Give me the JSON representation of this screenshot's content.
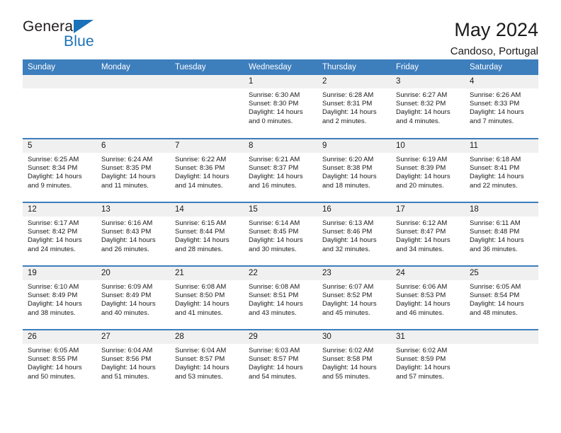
{
  "brand": {
    "name_part1": "General",
    "name_part2": "Blue",
    "accent_color": "#1b72b8",
    "triangle_icon": "triangle-icon"
  },
  "header": {
    "title": "May 2024",
    "subtitle": "Candoso, Portugal",
    "header_bg_color": "#3d7ebd",
    "header_text_color": "#ffffff"
  },
  "weekdays": [
    "Sunday",
    "Monday",
    "Tuesday",
    "Wednesday",
    "Thursday",
    "Friday",
    "Saturday"
  ],
  "labels": {
    "sunrise_prefix": "Sunrise:",
    "sunset_prefix": "Sunset:",
    "daylight_prefix": "Daylight:"
  },
  "weeks": [
    [
      {
        "day": "",
        "empty": true
      },
      {
        "day": "",
        "empty": true
      },
      {
        "day": "",
        "empty": true
      },
      {
        "day": "1",
        "sunrise": "Sunrise: 6:30 AM",
        "sunset": "Sunset: 8:30 PM",
        "daylight1": "Daylight: 14 hours",
        "daylight2": "and 0 minutes."
      },
      {
        "day": "2",
        "sunrise": "Sunrise: 6:28 AM",
        "sunset": "Sunset: 8:31 PM",
        "daylight1": "Daylight: 14 hours",
        "daylight2": "and 2 minutes."
      },
      {
        "day": "3",
        "sunrise": "Sunrise: 6:27 AM",
        "sunset": "Sunset: 8:32 PM",
        "daylight1": "Daylight: 14 hours",
        "daylight2": "and 4 minutes."
      },
      {
        "day": "4",
        "sunrise": "Sunrise: 6:26 AM",
        "sunset": "Sunset: 8:33 PM",
        "daylight1": "Daylight: 14 hours",
        "daylight2": "and 7 minutes."
      }
    ],
    [
      {
        "day": "5",
        "sunrise": "Sunrise: 6:25 AM",
        "sunset": "Sunset: 8:34 PM",
        "daylight1": "Daylight: 14 hours",
        "daylight2": "and 9 minutes."
      },
      {
        "day": "6",
        "sunrise": "Sunrise: 6:24 AM",
        "sunset": "Sunset: 8:35 PM",
        "daylight1": "Daylight: 14 hours",
        "daylight2": "and 11 minutes."
      },
      {
        "day": "7",
        "sunrise": "Sunrise: 6:22 AM",
        "sunset": "Sunset: 8:36 PM",
        "daylight1": "Daylight: 14 hours",
        "daylight2": "and 14 minutes."
      },
      {
        "day": "8",
        "sunrise": "Sunrise: 6:21 AM",
        "sunset": "Sunset: 8:37 PM",
        "daylight1": "Daylight: 14 hours",
        "daylight2": "and 16 minutes."
      },
      {
        "day": "9",
        "sunrise": "Sunrise: 6:20 AM",
        "sunset": "Sunset: 8:38 PM",
        "daylight1": "Daylight: 14 hours",
        "daylight2": "and 18 minutes."
      },
      {
        "day": "10",
        "sunrise": "Sunrise: 6:19 AM",
        "sunset": "Sunset: 8:39 PM",
        "daylight1": "Daylight: 14 hours",
        "daylight2": "and 20 minutes."
      },
      {
        "day": "11",
        "sunrise": "Sunrise: 6:18 AM",
        "sunset": "Sunset: 8:41 PM",
        "daylight1": "Daylight: 14 hours",
        "daylight2": "and 22 minutes."
      }
    ],
    [
      {
        "day": "12",
        "sunrise": "Sunrise: 6:17 AM",
        "sunset": "Sunset: 8:42 PM",
        "daylight1": "Daylight: 14 hours",
        "daylight2": "and 24 minutes."
      },
      {
        "day": "13",
        "sunrise": "Sunrise: 6:16 AM",
        "sunset": "Sunset: 8:43 PM",
        "daylight1": "Daylight: 14 hours",
        "daylight2": "and 26 minutes."
      },
      {
        "day": "14",
        "sunrise": "Sunrise: 6:15 AM",
        "sunset": "Sunset: 8:44 PM",
        "daylight1": "Daylight: 14 hours",
        "daylight2": "and 28 minutes."
      },
      {
        "day": "15",
        "sunrise": "Sunrise: 6:14 AM",
        "sunset": "Sunset: 8:45 PM",
        "daylight1": "Daylight: 14 hours",
        "daylight2": "and 30 minutes."
      },
      {
        "day": "16",
        "sunrise": "Sunrise: 6:13 AM",
        "sunset": "Sunset: 8:46 PM",
        "daylight1": "Daylight: 14 hours",
        "daylight2": "and 32 minutes."
      },
      {
        "day": "17",
        "sunrise": "Sunrise: 6:12 AM",
        "sunset": "Sunset: 8:47 PM",
        "daylight1": "Daylight: 14 hours",
        "daylight2": "and 34 minutes."
      },
      {
        "day": "18",
        "sunrise": "Sunrise: 6:11 AM",
        "sunset": "Sunset: 8:48 PM",
        "daylight1": "Daylight: 14 hours",
        "daylight2": "and 36 minutes."
      }
    ],
    [
      {
        "day": "19",
        "sunrise": "Sunrise: 6:10 AM",
        "sunset": "Sunset: 8:49 PM",
        "daylight1": "Daylight: 14 hours",
        "daylight2": "and 38 minutes."
      },
      {
        "day": "20",
        "sunrise": "Sunrise: 6:09 AM",
        "sunset": "Sunset: 8:49 PM",
        "daylight1": "Daylight: 14 hours",
        "daylight2": "and 40 minutes."
      },
      {
        "day": "21",
        "sunrise": "Sunrise: 6:08 AM",
        "sunset": "Sunset: 8:50 PM",
        "daylight1": "Daylight: 14 hours",
        "daylight2": "and 41 minutes."
      },
      {
        "day": "22",
        "sunrise": "Sunrise: 6:08 AM",
        "sunset": "Sunset: 8:51 PM",
        "daylight1": "Daylight: 14 hours",
        "daylight2": "and 43 minutes."
      },
      {
        "day": "23",
        "sunrise": "Sunrise: 6:07 AM",
        "sunset": "Sunset: 8:52 PM",
        "daylight1": "Daylight: 14 hours",
        "daylight2": "and 45 minutes."
      },
      {
        "day": "24",
        "sunrise": "Sunrise: 6:06 AM",
        "sunset": "Sunset: 8:53 PM",
        "daylight1": "Daylight: 14 hours",
        "daylight2": "and 46 minutes."
      },
      {
        "day": "25",
        "sunrise": "Sunrise: 6:05 AM",
        "sunset": "Sunset: 8:54 PM",
        "daylight1": "Daylight: 14 hours",
        "daylight2": "and 48 minutes."
      }
    ],
    [
      {
        "day": "26",
        "sunrise": "Sunrise: 6:05 AM",
        "sunset": "Sunset: 8:55 PM",
        "daylight1": "Daylight: 14 hours",
        "daylight2": "and 50 minutes."
      },
      {
        "day": "27",
        "sunrise": "Sunrise: 6:04 AM",
        "sunset": "Sunset: 8:56 PM",
        "daylight1": "Daylight: 14 hours",
        "daylight2": "and 51 minutes."
      },
      {
        "day": "28",
        "sunrise": "Sunrise: 6:04 AM",
        "sunset": "Sunset: 8:57 PM",
        "daylight1": "Daylight: 14 hours",
        "daylight2": "and 53 minutes."
      },
      {
        "day": "29",
        "sunrise": "Sunrise: 6:03 AM",
        "sunset": "Sunset: 8:57 PM",
        "daylight1": "Daylight: 14 hours",
        "daylight2": "and 54 minutes."
      },
      {
        "day": "30",
        "sunrise": "Sunrise: 6:02 AM",
        "sunset": "Sunset: 8:58 PM",
        "daylight1": "Daylight: 14 hours",
        "daylight2": "and 55 minutes."
      },
      {
        "day": "31",
        "sunrise": "Sunrise: 6:02 AM",
        "sunset": "Sunset: 8:59 PM",
        "daylight1": "Daylight: 14 hours",
        "daylight2": "and 57 minutes."
      },
      {
        "day": "",
        "empty": true
      }
    ]
  ]
}
